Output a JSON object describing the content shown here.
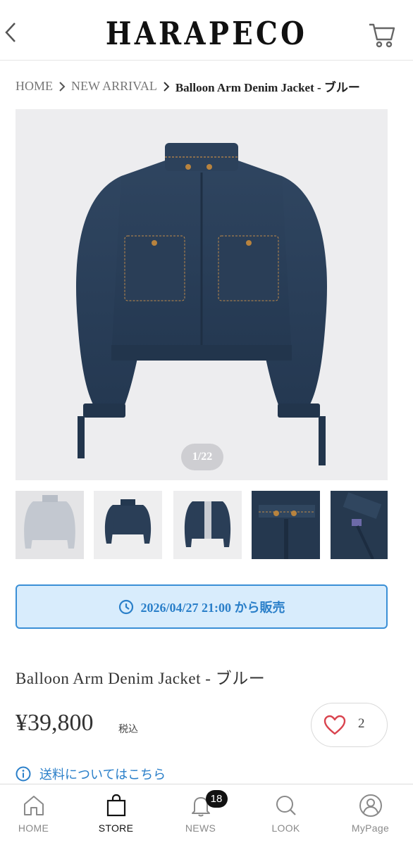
{
  "header": {
    "logo": "HARAPECO",
    "back_icon": "chevron-left-icon",
    "cart_icon": "cart-icon"
  },
  "breadcrumb": {
    "items": [
      "HOME",
      "NEW ARRIVAL",
      "Balloon Arm Denim Jacket - ブルー"
    ]
  },
  "gallery": {
    "counter": "1/22",
    "current_index": 1,
    "total": 22
  },
  "sale": {
    "icon": "clock-icon",
    "text": "2026/04/27 21:00 から販売"
  },
  "product": {
    "name": "Balloon Arm Denim Jacket - ブルー",
    "price": "¥39,800",
    "tax_label": "税込",
    "favorite_count": "2",
    "favorite_icon": "heart-icon"
  },
  "shipping": {
    "icon": "info-icon",
    "link_text": "送料についてはこちら"
  },
  "tabbar": {
    "items": [
      {
        "label": "HOME",
        "icon": "home-icon",
        "active": false
      },
      {
        "label": "STORE",
        "icon": "shopping-bag-icon",
        "active": true
      },
      {
        "label": "NEWS",
        "icon": "bell-icon",
        "badge": "18",
        "active": false
      },
      {
        "label": "LOOK",
        "icon": "search-icon",
        "active": false
      },
      {
        "label": "MyPage",
        "icon": "user-icon",
        "active": false
      }
    ]
  },
  "colors": {
    "accent_blue": "#2a7fc9",
    "sale_bg": "#d8ecfc",
    "heart_red": "#d9434e",
    "denim": "#2b3f58"
  }
}
